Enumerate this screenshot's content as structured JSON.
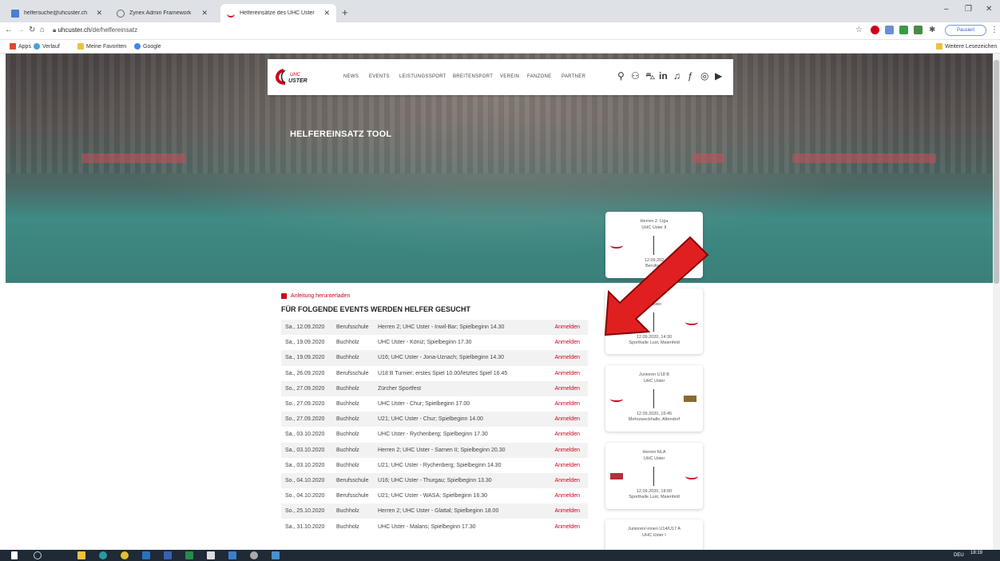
{
  "browser": {
    "tabs": [
      {
        "label": "helfersuche@uhcuster.ch",
        "active": false
      },
      {
        "label": "Zynex Admin Framework",
        "active": false
      },
      {
        "label": "Helfereinsätze des UHC Uster",
        "active": true
      }
    ],
    "new_tab": "+",
    "url_host": "uhcuster.ch",
    "url_path": "/de/helfereinsatz",
    "paused_label": "Pausiert",
    "bookmarks": [
      "Apps",
      "Verlauf",
      "Meine Favoriten",
      "Google"
    ],
    "other_bookmarks": "Weitere Lesezeichen"
  },
  "site": {
    "logo_text": "UHC USTER",
    "nav": [
      "NEWS",
      "EVENTS",
      "LEISTUNGSSPORT",
      "BREITENSPORT",
      "VEREIN",
      "FANZONE",
      "PARTNER"
    ],
    "hero_title": "HELFEREINSATZ TOOL"
  },
  "content": {
    "download_label": "Anleitung herunterladen",
    "heading": "FÜR FOLGENDE EVENTS WERDEN HELFER GESUCHT",
    "action_label": "Anmelden",
    "events": [
      {
        "date": "Sa., 12.09.2020",
        "place": "Berufsschule",
        "title": "Herren 2; UHC Uster - Inwil-Bar; Spielbeginn 14.30"
      },
      {
        "date": "Sa., 19.09.2020",
        "place": "Buchholz",
        "title": "UHC Uster - Köniz; Spielbeginn 17.30"
      },
      {
        "date": "Sa., 19.09.2020",
        "place": "Buchholz",
        "title": "U16; UHC Uster - Jona-Uznach; Spielbeginn 14.30"
      },
      {
        "date": "Sa., 26.09.2020",
        "place": "Berufsschule",
        "title": "U18 B Turnier; erstes Spiel 10.00/letztes Spiel 16.45"
      },
      {
        "date": "So., 27.09.2020",
        "place": "Buchholz",
        "title": "Zürcher Sportfest"
      },
      {
        "date": "So., 27.09.2020",
        "place": "Buchholz",
        "title": "UHC Uster - Chur; Spielbeginn 17.00"
      },
      {
        "date": "So., 27.09.2020",
        "place": "Buchholz",
        "title": "U21; UHC Uster - Chur; Spielbeginn 14.00"
      },
      {
        "date": "Sa., 03.10.2020",
        "place": "Buchholz",
        "title": "UHC Uster - Rychenberg; Spielbeginn 17.30"
      },
      {
        "date": "Sa., 03.10.2020",
        "place": "Buchholz",
        "title": "Herren 2; UHC Uster - Sarnen II; Spielbeginn 20.30"
      },
      {
        "date": "Sa., 03.10.2020",
        "place": "Buchholz",
        "title": "U21; UHC Uster - Rychenberg; Spielbeginn 14.30"
      },
      {
        "date": "So., 04.10.2020",
        "place": "Berufsschule",
        "title": "U16; UHC Uster - Thurgau; Spielbeginn 13.30"
      },
      {
        "date": "So., 04.10.2020",
        "place": "Berufsschule",
        "title": "U21; UHC Uster - WASA; Spielbeginn 16.30"
      },
      {
        "date": "So., 25.10.2020",
        "place": "Buchholz",
        "title": "Herren 2; UHC Uster - Glattal; Spielbeginn 18.00"
      },
      {
        "date": "Sa., 31.10.2020",
        "place": "Buchholz",
        "title": "UHC Uster - Malans; Spielbeginn 17.30"
      }
    ]
  },
  "cards": [
    {
      "league": "Herren 2. Liga",
      "team": "UHC Uster II",
      "datetime": "12.09.202",
      "venue": "Berufsch"
    },
    {
      "league": "U21 A",
      "team": "C Uster",
      "datetime": "12.09.2020, 14:30",
      "venue": "Sporthalle Lust, Maienfeld"
    },
    {
      "league": "Junioren U18 B",
      "team": "UHC Uster",
      "datetime": "12.09.2020, 16:45",
      "venue": "Mehrzweckhalle, Altendorf"
    },
    {
      "league": "Herren NLA",
      "team": "UHC Uster",
      "datetime": "12.09.2020, 18:00",
      "venue": "Sporthalle Lust, Maienfeld"
    },
    {
      "league": "Junioren/-innen U14/U17 A",
      "team": "UHC Uster I",
      "datetime": "",
      "venue": ""
    }
  ],
  "taskbar": {
    "lang": "DEU",
    "time": "18:19"
  },
  "colors": {
    "accent": "#d0021b",
    "tabbar": "#dee1e6",
    "taskbar": "#1f2a36"
  }
}
